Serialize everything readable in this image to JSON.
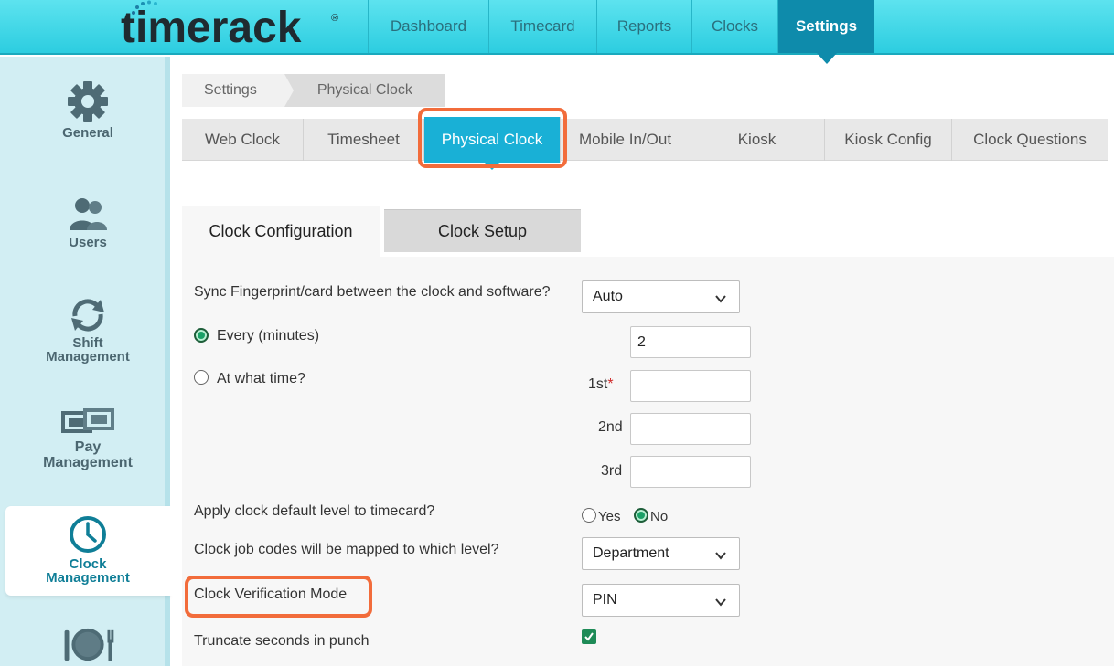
{
  "brand": {
    "name": "timerack",
    "registered": "®"
  },
  "nav": [
    {
      "label": "Dashboard"
    },
    {
      "label": "Timecard"
    },
    {
      "label": "Reports"
    },
    {
      "label": "Clocks"
    },
    {
      "label": "Settings",
      "active": true
    }
  ],
  "sidebar": {
    "general": "General",
    "users": "Users",
    "shift_1": "Shift",
    "shift_2": "Management",
    "pay_1": "Pay",
    "pay_2": "Management",
    "clock_1": "Clock",
    "clock_2": "Management"
  },
  "breadcrumb": {
    "root": "Settings",
    "current": "Physical Clock"
  },
  "tabs": [
    {
      "label": "Web Clock"
    },
    {
      "label": "Timesheet"
    },
    {
      "label": "Physical Clock",
      "active": true
    },
    {
      "label": "Mobile In/Out"
    },
    {
      "label": "Kiosk"
    },
    {
      "label": "Kiosk Config"
    },
    {
      "label": "Clock Questions"
    }
  ],
  "subtabs": {
    "active": "Clock Configuration",
    "inactive": "Clock Setup"
  },
  "form": {
    "sync_label": "Sync Fingerprint/card between the clock and software?",
    "sync_value": "Auto",
    "every_label": "Every (minutes)",
    "every_value": "2",
    "at_time_label": "At what time?",
    "first_label": "1st",
    "required_mark": "*",
    "second_label": "2nd",
    "third_label": "3rd",
    "default_level_label": "Apply clock default level to timecard?",
    "yes_label": "Yes",
    "no_label": "No",
    "default_level_value": "No",
    "job_codes_label": "Clock job codes will be mapped to which level?",
    "job_codes_value": "Department",
    "verification_label": "Clock Verification Mode",
    "verification_value": "PIN",
    "truncate_label": "Truncate seconds in punch",
    "truncate_checked": true
  },
  "colors": {
    "topbar": "#2ccde0",
    "active_nav": "#0e8bab",
    "active_tab": "#19b0d6",
    "highlight": "#f26c3b",
    "radio_on": "#1aa167"
  }
}
